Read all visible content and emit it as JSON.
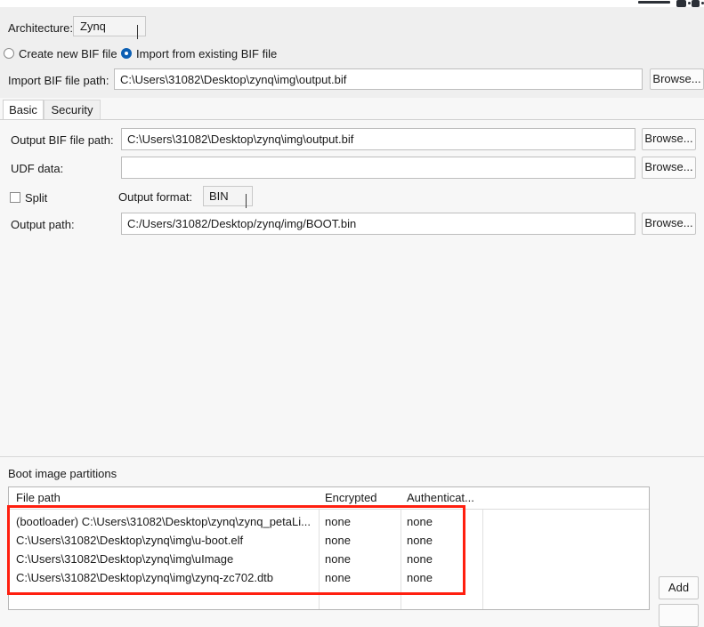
{
  "window": {
    "controls": {
      "minimize": "minimize-control",
      "maximize": "maximize-control",
      "close": "close-control"
    }
  },
  "header": {
    "architecture_label": "Architecture:",
    "architecture_value": "Zynq",
    "architecture_options": [
      "Zynq"
    ],
    "radios": [
      {
        "label": "Create new BIF file",
        "checked": false
      },
      {
        "label": "Import from existing BIF file",
        "checked": true
      }
    ],
    "import_bif_label": "Import BIF file path:",
    "import_bif_value": "C:\\Users\\31082\\Desktop\\zynq\\img\\output.bif",
    "import_bif_placeholder": "",
    "browse_label": "Browse..."
  },
  "tabs": [
    {
      "label": "Basic",
      "selected": true
    },
    {
      "label": "Security",
      "selected": false
    }
  ],
  "basic": {
    "output_bif_label": "Output BIF file path:",
    "output_bif_value": "C:\\Users\\31082\\Desktop\\zynq\\img\\output.bif",
    "output_bif_placeholder": "",
    "browse_output_bif_label": "Browse...",
    "udf_label": "UDF data:",
    "udf_value": "",
    "udf_placeholder": "",
    "browse_udf_label": "Browse...",
    "split_label": "Split",
    "split_checked": false,
    "output_format_label": "Output format:",
    "output_format_value": "BIN",
    "output_format_options": [
      "BIN"
    ],
    "output_path_label": "Output path:",
    "output_path_value": "C:/Users/31082/Desktop/zynq/img/BOOT.bin",
    "output_path_placeholder": "",
    "browse_output_path_label": "Browse..."
  },
  "partitions": {
    "title": "Boot image partitions",
    "columns": [
      "File path",
      "Encrypted",
      "Authenticat..."
    ],
    "rows": [
      {
        "file_path": "(bootloader) C:\\Users\\31082\\Desktop\\zynq\\zynq_petaLi...",
        "encrypted": "none",
        "authenticated": "none"
      },
      {
        "file_path": "C:\\Users\\31082\\Desktop\\zynq\\img\\u-boot.elf",
        "encrypted": "none",
        "authenticated": "none"
      },
      {
        "file_path": "C:\\Users\\31082\\Desktop\\zynq\\img\\uImage",
        "encrypted": "none",
        "authenticated": "none"
      },
      {
        "file_path": "C:\\Users\\31082\\Desktop\\zynq\\img\\zynq-zc702.dtb",
        "encrypted": "none",
        "authenticated": "none"
      }
    ],
    "add_label": "Add"
  },
  "colors": {
    "accent": "#0c5fb3",
    "annotation": "#ff1f0f",
    "panel_bg": "#f7f7f7",
    "header_bg": "#efefef",
    "field_bg": "#ffffff",
    "border": "#bdbdbd"
  }
}
